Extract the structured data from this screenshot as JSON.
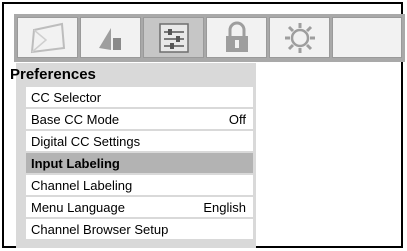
{
  "tabs": [
    {
      "icon": "picture-icon",
      "active": false
    },
    {
      "icon": "audio-icon",
      "active": false
    },
    {
      "icon": "preferences-icon",
      "active": true
    },
    {
      "icon": "lock-icon",
      "active": false
    },
    {
      "icon": "setup-gear-icon",
      "active": false
    }
  ],
  "panel": {
    "title": "Preferences",
    "items": [
      {
        "label": "CC Selector",
        "value": ""
      },
      {
        "label": "Base CC Mode",
        "value": "Off"
      },
      {
        "label": "Digital CC Settings",
        "value": ""
      },
      {
        "label": "Input Labeling",
        "value": "",
        "selected": true
      },
      {
        "label": "Channel Labeling",
        "value": ""
      },
      {
        "label": "Menu Language",
        "value": "English"
      },
      {
        "label": "Channel Browser Setup",
        "value": ""
      }
    ]
  },
  "colors": {
    "tabbar": "#a9a9a9",
    "panel": "#d9d9d9",
    "selected_row": "#b3b3b3",
    "active_tab": "#c6c6c6"
  }
}
